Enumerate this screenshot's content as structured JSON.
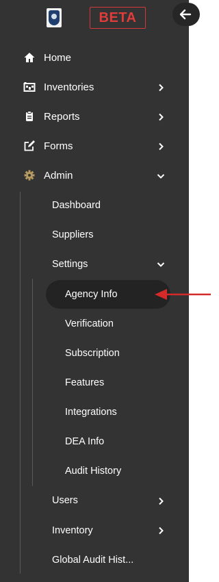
{
  "brand": {
    "beta_label": "BETA"
  },
  "nav": {
    "home": "Home",
    "inventories": "Inventories",
    "reports": "Reports",
    "forms": "Forms",
    "admin": "Admin"
  },
  "admin_menu": {
    "dashboard": "Dashboard",
    "suppliers": "Suppliers",
    "settings": "Settings",
    "users": "Users",
    "inventory": "Inventory",
    "global_audit": "Global Audit Hist..."
  },
  "settings_menu": {
    "agency_info": "Agency Info",
    "verification": "Verification",
    "subscription": "Subscription",
    "features": "Features",
    "integrations": "Integrations",
    "dea_info": "DEA Info",
    "audit_history": "Audit History"
  },
  "colors": {
    "sidebar_bg": "#333333",
    "active_bg": "#232323",
    "admin_icon": "#b59b63",
    "beta": "#e03c3c",
    "arrow": "#d42a2a"
  },
  "icons": {
    "home": "home-icon",
    "inventories": "inventory-icon",
    "reports": "clipboard-icon",
    "forms": "edit-icon",
    "admin": "gear-icon"
  }
}
